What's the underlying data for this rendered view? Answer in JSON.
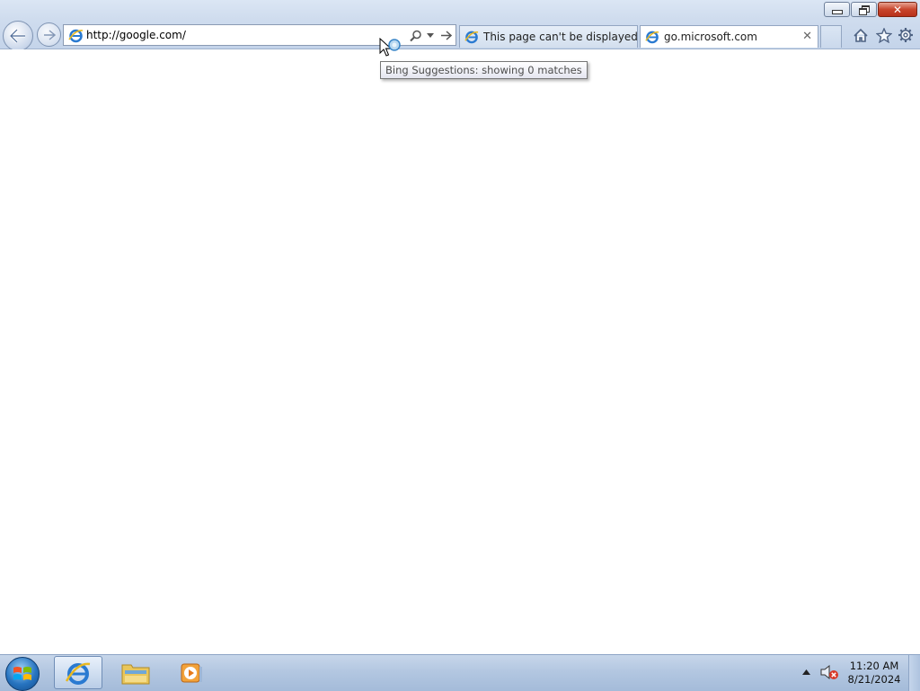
{
  "window": {
    "minimize_label": "minimize",
    "restore_label": "restore",
    "close_label": "close"
  },
  "address_bar": {
    "url": "http://google.com/"
  },
  "tabs": [
    {
      "label": "This page can't be displayed",
      "active": false
    },
    {
      "label": "go.microsoft.com",
      "active": true,
      "close": "✕"
    }
  ],
  "tooltip": {
    "text": "Bing Suggestions: showing 0 matches"
  },
  "taskbar": {
    "items": [
      "internet-explorer",
      "windows-explorer",
      "windows-media-player"
    ],
    "clock": {
      "time": "11:20 AM",
      "date": "8/21/2024"
    }
  },
  "colors": {
    "chrome": "#cfdcee",
    "taskbar": "#b3c7e1",
    "close_red": "#c8452c"
  }
}
